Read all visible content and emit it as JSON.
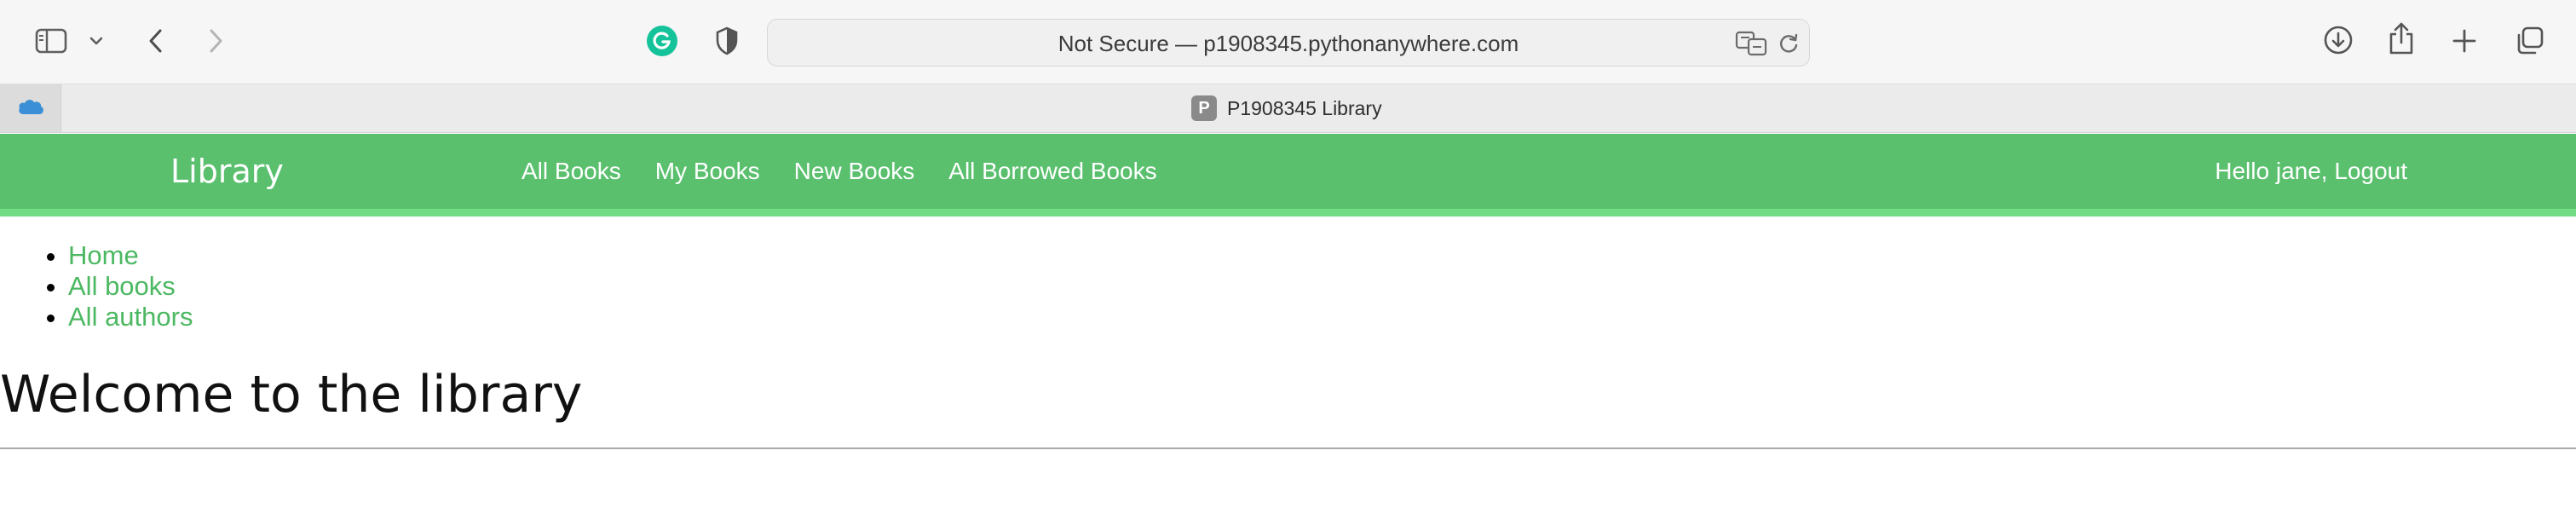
{
  "browser": {
    "url_text": "Not Secure — p1908345.pythonanywhere.com",
    "active_tab": {
      "favicon_letter": "P",
      "title": "P1908345 Library"
    },
    "icons": {
      "sidebar_toggle": "sidebar-icon",
      "sidebar_menu": "chevron-down-icon",
      "back": "chevron-left-icon",
      "forward": "chevron-right-icon",
      "extension_grammarly": "grammarly-icon",
      "privacy": "shield-icon",
      "translate": "translate-icon",
      "reload": "reload-icon",
      "downloads": "download-icon",
      "share": "share-icon",
      "new_tab": "plus-icon",
      "tab_overview": "tabs-icon",
      "pinned_tab": "cloud-icon"
    }
  },
  "navbar": {
    "brand": "Library",
    "links": [
      {
        "label": "All Books"
      },
      {
        "label": "My Books"
      },
      {
        "label": "New Books"
      },
      {
        "label": "All Borrowed Books"
      }
    ],
    "user_text": "Hello jane, Logout"
  },
  "sidebar": {
    "items": [
      {
        "label": "Home"
      },
      {
        "label": "All books"
      },
      {
        "label": "All authors"
      }
    ]
  },
  "main": {
    "heading": "Welcome to the library"
  },
  "colors": {
    "navbar": "#5ac06e",
    "navbar_accent": "#71dc84",
    "link": "#4cb862",
    "grammarly": "#15c39a"
  }
}
